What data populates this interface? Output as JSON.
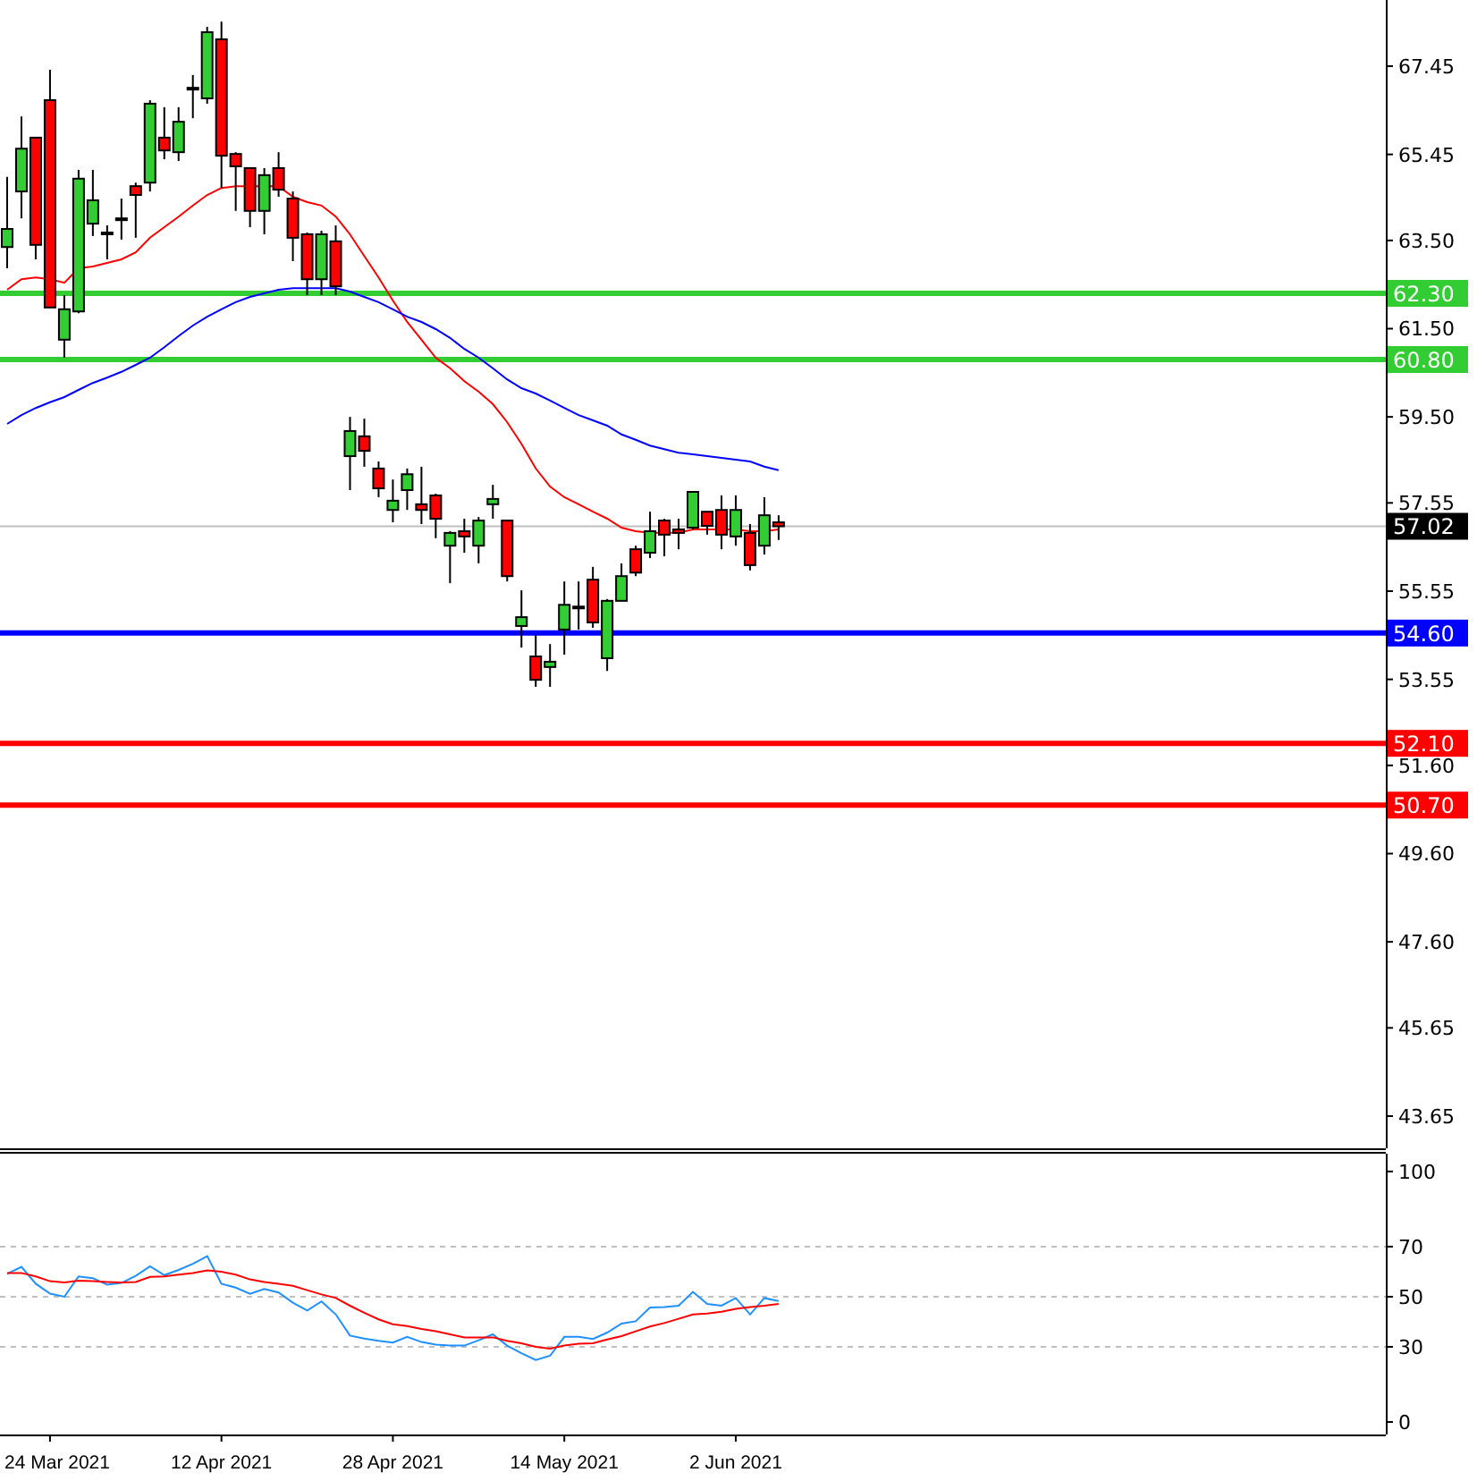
{
  "price_chart": {
    "chart_data": {
      "type": "candlestick",
      "categories": [
        null,
        null,
        null,
        null,
        null,
        null,
        null,
        null,
        null,
        null,
        null,
        null,
        null,
        null,
        null,
        null,
        null,
        null,
        null,
        null,
        null,
        null,
        null,
        null,
        null,
        null,
        null,
        null,
        null,
        null,
        null,
        null,
        null,
        null,
        null,
        null,
        null,
        null,
        null,
        null,
        null,
        null,
        null,
        null,
        null,
        null,
        null,
        null,
        null,
        null,
        null,
        null,
        null,
        null,
        null,
        null,
        null,
        null,
        null,
        null,
        null,
        null,
        null,
        null,
        null,
        null,
        null,
        null,
        null,
        null,
        null,
        null,
        null,
        null,
        null,
        null,
        null,
        null,
        null,
        null,
        null,
        null,
        null,
        null,
        null,
        null,
        null,
        null,
        null,
        null,
        null,
        null,
        null,
        null,
        null,
        null,
        null
      ],
      "ylim": [
        42.92,
        68.95
      ],
      "yticks": [
        {
          "value": 67.45,
          "label": "67.45"
        },
        {
          "value": 65.45,
          "label": "65.45"
        },
        {
          "value": 63.5,
          "label": "63.50"
        },
        {
          "value": 61.5,
          "label": "61.50"
        },
        {
          "value": 59.5,
          "label": "59.50"
        },
        {
          "value": 57.55,
          "label": "57.55"
        },
        {
          "value": 55.55,
          "label": "55.55"
        },
        {
          "value": 53.55,
          "label": "53.55"
        },
        {
          "value": 51.6,
          "label": "51.60"
        },
        {
          "value": 49.6,
          "label": "49.60"
        },
        {
          "value": 47.6,
          "label": "47.60"
        },
        {
          "value": 45.65,
          "label": "45.65"
        },
        {
          "value": 43.65,
          "label": "43.65"
        }
      ],
      "ohlc": [
        [
          63.35,
          64.94,
          62.87,
          63.76
        ],
        [
          64.61,
          66.31,
          64.0,
          65.58
        ],
        [
          65.83,
          65.83,
          63.07,
          63.4
        ],
        [
          66.68,
          67.37,
          61.98,
          61.98
        ],
        [
          61.25,
          62.26,
          60.84,
          61.94
        ],
        [
          61.89,
          65.1,
          61.85,
          64.9
        ],
        [
          63.88,
          65.1,
          63.6,
          64.41
        ],
        [
          63.68,
          63.84,
          63.07,
          63.68
        ],
        [
          64.0,
          64.45,
          63.52,
          64.0
        ],
        [
          64.73,
          64.81,
          63.56,
          64.53
        ],
        [
          64.81,
          66.68,
          64.61,
          66.6
        ],
        [
          65.83,
          66.52,
          65.34,
          65.54
        ],
        [
          65.5,
          66.52,
          65.3,
          66.19
        ],
        [
          66.96,
          67.25,
          66.27,
          66.96
        ],
        [
          66.72,
          68.34,
          66.6,
          68.22
        ],
        [
          68.06,
          68.46,
          64.69,
          65.42
        ],
        [
          65.46,
          65.5,
          64.17,
          65.18
        ],
        [
          65.14,
          65.14,
          63.8,
          64.17
        ],
        [
          64.17,
          65.14,
          63.64,
          64.98
        ],
        [
          65.14,
          65.5,
          64.49,
          64.65
        ],
        [
          64.45,
          64.61,
          63.03,
          63.56
        ],
        [
          63.64,
          63.68,
          62.26,
          62.62
        ],
        [
          62.62,
          63.72,
          62.26,
          63.64
        ],
        [
          63.48,
          63.84,
          62.26,
          62.46
        ],
        [
          58.61,
          59.5,
          57.84,
          59.18
        ],
        [
          59.06,
          59.46,
          58.37,
          58.73
        ],
        [
          58.33,
          58.49,
          57.68,
          57.88
        ],
        [
          57.39,
          58.08,
          57.11,
          57.6
        ],
        [
          57.84,
          58.33,
          57.39,
          58.2
        ],
        [
          57.52,
          58.37,
          57.07,
          57.39
        ],
        [
          57.72,
          57.76,
          56.75,
          57.19
        ],
        [
          56.58,
          56.91,
          55.73,
          56.87
        ],
        [
          56.91,
          57.19,
          56.42,
          56.79
        ],
        [
          56.58,
          57.23,
          56.18,
          57.15
        ],
        [
          57.52,
          57.96,
          57.19,
          57.64
        ],
        [
          57.15,
          57.15,
          55.77,
          55.89
        ],
        [
          54.76,
          55.57,
          54.27,
          54.96
        ],
        [
          54.07,
          54.55,
          53.38,
          53.54
        ],
        [
          53.83,
          54.35,
          53.38,
          53.95
        ],
        [
          54.68,
          55.77,
          54.11,
          55.24
        ],
        [
          55.2,
          55.77,
          54.68,
          55.2
        ],
        [
          55.81,
          56.1,
          54.72,
          54.84
        ],
        [
          54.03,
          55.37,
          53.74,
          55.33
        ],
        [
          55.33,
          56.18,
          55.33,
          55.89
        ],
        [
          56.5,
          56.58,
          55.89,
          55.97
        ],
        [
          56.42,
          57.35,
          56.3,
          56.91
        ],
        [
          57.15,
          57.19,
          56.34,
          56.83
        ],
        [
          56.95,
          57.19,
          56.5,
          56.87
        ],
        [
          56.99,
          57.8,
          56.95,
          57.8
        ],
        [
          57.35,
          57.35,
          56.83,
          57.03
        ],
        [
          57.39,
          57.72,
          56.5,
          56.83
        ],
        [
          56.79,
          57.72,
          56.58,
          57.39
        ],
        [
          56.87,
          57.07,
          56.02,
          56.14
        ],
        [
          56.58,
          57.68,
          56.38,
          57.27
        ],
        [
          57.11,
          57.27,
          56.71,
          57.02
        ],
        null,
        null,
        null,
        null,
        null,
        null,
        null,
        null,
        null,
        null,
        null,
        null,
        null,
        null,
        null,
        null,
        null,
        null,
        null,
        null,
        null,
        null,
        null,
        null,
        null,
        null,
        null,
        null,
        null,
        null,
        null,
        null,
        null,
        null,
        null,
        null,
        null,
        null,
        null,
        null,
        null,
        null
      ],
      "series": [
        {
          "type": "line",
          "color": "#ff0000",
          "values": [
            62.38,
            62.62,
            62.66,
            62.62,
            62.54,
            62.87,
            62.91,
            62.99,
            63.07,
            63.23,
            63.56,
            63.8,
            64.04,
            64.29,
            64.53,
            64.69,
            64.73,
            64.73,
            64.73,
            64.73,
            64.49,
            64.37,
            64.29,
            64.04,
            63.64,
            63.15,
            62.66,
            62.14,
            61.65,
            61.25,
            60.84,
            60.6,
            60.31,
            60.07,
            59.79,
            59.38,
            58.89,
            58.33,
            57.92,
            57.68,
            57.52,
            57.35,
            57.19,
            56.99,
            56.91,
            56.87,
            56.87,
            56.87,
            56.95,
            56.95,
            56.95,
            56.95,
            56.91,
            56.91,
            56.95,
            null,
            null,
            null,
            null,
            null,
            null,
            null,
            null,
            null,
            null,
            null,
            null,
            null,
            null,
            null,
            null,
            null,
            null,
            null,
            null,
            null,
            null,
            null,
            null,
            null,
            null,
            null,
            null,
            null,
            null,
            null,
            null,
            null,
            null,
            null,
            null,
            null,
            null,
            null,
            null,
            null,
            null
          ]
        },
        {
          "type": "line",
          "color": "#0000ff",
          "values": [
            59.34,
            59.54,
            59.7,
            59.83,
            59.95,
            60.11,
            60.27,
            60.39,
            60.52,
            60.68,
            60.84,
            61.08,
            61.33,
            61.57,
            61.77,
            61.94,
            62.1,
            62.22,
            62.3,
            62.38,
            62.42,
            62.42,
            62.42,
            62.42,
            62.34,
            62.22,
            62.1,
            61.94,
            61.77,
            61.65,
            61.49,
            61.29,
            61.04,
            60.84,
            60.6,
            60.35,
            60.15,
            60.03,
            59.87,
            59.7,
            59.54,
            59.42,
            59.3,
            59.1,
            58.98,
            58.85,
            58.77,
            58.69,
            58.65,
            58.61,
            58.57,
            58.53,
            58.49,
            58.37,
            58.29,
            null,
            null,
            null,
            null,
            null,
            null,
            null,
            null,
            null,
            null,
            null,
            null,
            null,
            null,
            null,
            null,
            null,
            null,
            null,
            null,
            null,
            null,
            null,
            null,
            null,
            null,
            null,
            null,
            null,
            null,
            null,
            null,
            null,
            null,
            null,
            null,
            null,
            null,
            null,
            null,
            null,
            null
          ]
        }
      ],
      "ref_lines": [
        {
          "axis": "y",
          "value": 62.3,
          "label": "62.30",
          "color": "#32cd32"
        },
        {
          "axis": "y",
          "value": 60.8,
          "label": "60.80",
          "color": "#32cd32"
        },
        {
          "axis": "y",
          "value": 57.02,
          "label": "57.02",
          "color": "#c0c0c0"
        },
        {
          "axis": "y",
          "value": 54.6,
          "label": "54.60",
          "color": "#0000ff"
        },
        {
          "axis": "y",
          "value": 52.1,
          "label": "52.10",
          "color": "#ff0000"
        },
        {
          "axis": "y",
          "value": 50.7,
          "label": "50.70",
          "color": "#ff0000"
        }
      ]
    }
  },
  "oscillator": {
    "chart_data": {
      "type": "line",
      "categories": [
        null,
        null,
        null,
        "24 Mar 2021",
        null,
        null,
        null,
        null,
        null,
        null,
        null,
        null,
        null,
        null,
        null,
        "12 Apr 2021",
        null,
        null,
        null,
        null,
        null,
        null,
        null,
        null,
        null,
        null,
        null,
        "28 Apr 2021",
        null,
        null,
        null,
        null,
        null,
        null,
        null,
        null,
        null,
        null,
        null,
        "14 May 2021",
        null,
        null,
        null,
        null,
        null,
        null,
        null,
        null,
        null,
        null,
        null,
        "2 Jun 2021",
        null,
        null,
        null,
        null,
        null,
        null,
        null,
        null,
        null,
        null,
        null,
        null,
        null,
        null,
        null,
        null,
        null,
        null,
        null,
        null,
        null,
        null,
        null,
        null,
        null,
        null,
        null,
        null,
        null,
        null,
        null,
        null,
        null,
        null,
        null,
        null,
        null,
        null,
        null,
        null,
        null,
        null,
        null,
        null,
        null
      ],
      "ylim": [
        -5,
        107.1
      ],
      "yticks": [
        100,
        70,
        50,
        30,
        0
      ],
      "grid": true,
      "series": [
        {
          "color": "#1e90ff",
          "values": [
            59.1,
            61.9,
            55.2,
            51.2,
            50.0,
            58.1,
            57.4,
            54.8,
            55.5,
            58.3,
            62.1,
            58.6,
            60.7,
            63.1,
            66.2,
            55.2,
            53.6,
            51.2,
            53.1,
            51.7,
            47.6,
            44.5,
            48.1,
            42.9,
            34.5,
            33.3,
            32.4,
            31.7,
            34.0,
            31.9,
            30.9,
            30.5,
            30.5,
            32.6,
            35.0,
            30.5,
            27.4,
            24.8,
            26.4,
            34.0,
            34.0,
            33.1,
            35.7,
            39.3,
            40.2,
            45.7,
            45.9,
            46.4,
            51.9,
            47.1,
            46.4,
            49.5,
            42.9,
            49.5,
            48.3,
            null,
            null,
            null,
            null,
            null,
            null,
            null,
            null,
            null,
            null,
            null,
            null,
            null,
            null,
            null,
            null,
            null,
            null,
            null,
            null,
            null,
            null,
            null,
            null,
            null,
            null,
            null,
            null,
            null,
            null,
            null,
            null,
            null,
            null,
            null,
            null,
            null,
            null,
            null,
            null,
            null,
            null
          ]
        },
        {
          "color": "#ff0000",
          "values": [
            59.5,
            59.5,
            58.1,
            56.2,
            55.7,
            56.4,
            56.2,
            55.9,
            55.7,
            55.9,
            57.9,
            58.1,
            58.8,
            59.5,
            60.5,
            60.0,
            58.8,
            56.9,
            55.9,
            55.2,
            54.3,
            52.6,
            50.9,
            49.5,
            46.4,
            43.6,
            41.0,
            39.0,
            38.3,
            37.1,
            36.2,
            35.0,
            33.8,
            33.8,
            33.8,
            32.4,
            31.4,
            30.0,
            29.3,
            30.5,
            31.2,
            31.4,
            32.9,
            34.3,
            36.2,
            38.1,
            39.5,
            41.2,
            42.9,
            43.3,
            44.0,
            45.2,
            45.9,
            46.4,
            47.1,
            null,
            null,
            null,
            null,
            null,
            null,
            null,
            null,
            null,
            null,
            null,
            null,
            null,
            null,
            null,
            null,
            null,
            null,
            null,
            null,
            null,
            null,
            null,
            null,
            null,
            null,
            null,
            null,
            null,
            null,
            null,
            null,
            null,
            null,
            null,
            null,
            null,
            null,
            null,
            null,
            null,
            null
          ]
        }
      ]
    }
  }
}
